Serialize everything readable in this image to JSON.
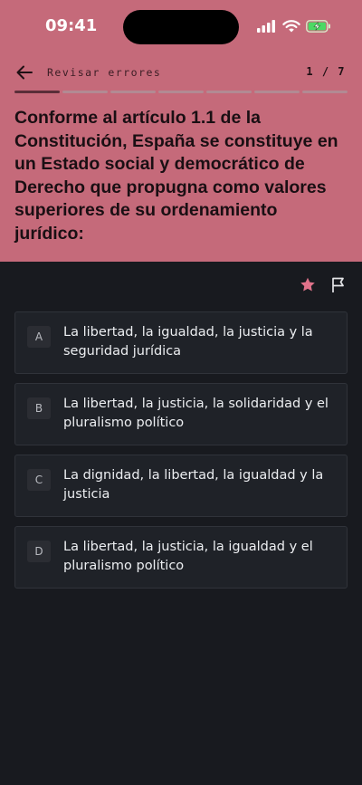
{
  "status_bar": {
    "time": "09:41",
    "icons": [
      "cellular-signal-icon",
      "wifi-icon",
      "battery-charging-icon"
    ]
  },
  "header": {
    "back_icon": "arrow-left-icon",
    "title": "Revisar errores",
    "counter": "1 / 7",
    "progress": {
      "total": 7,
      "current": 1
    },
    "question": "Conforme al artículo 1.1 de la Constitución, España se constituye en un Estado social y democrático de Derecho que propugna como valores superiores de su ordenamiento jurídico:"
  },
  "tools": {
    "favorite_icon": "star-icon",
    "report_icon": "flag-icon"
  },
  "options": [
    {
      "letter": "A",
      "text": "La libertad, la igualdad, la justicia y la seguridad jurídica"
    },
    {
      "letter": "B",
      "text": "La libertad, la justicia, la solidaridad y el pluralismo político"
    },
    {
      "letter": "C",
      "text": "La dignidad, la libertad, la igualdad y la justicia"
    },
    {
      "letter": "D",
      "text": "La libertad, la justicia, la igualdad y el pluralismo político"
    }
  ],
  "colors": {
    "header_bg": "#c56a7a",
    "body_bg": "#181a1f",
    "accent": "#e0728a",
    "card_bg": "#1f2228"
  }
}
